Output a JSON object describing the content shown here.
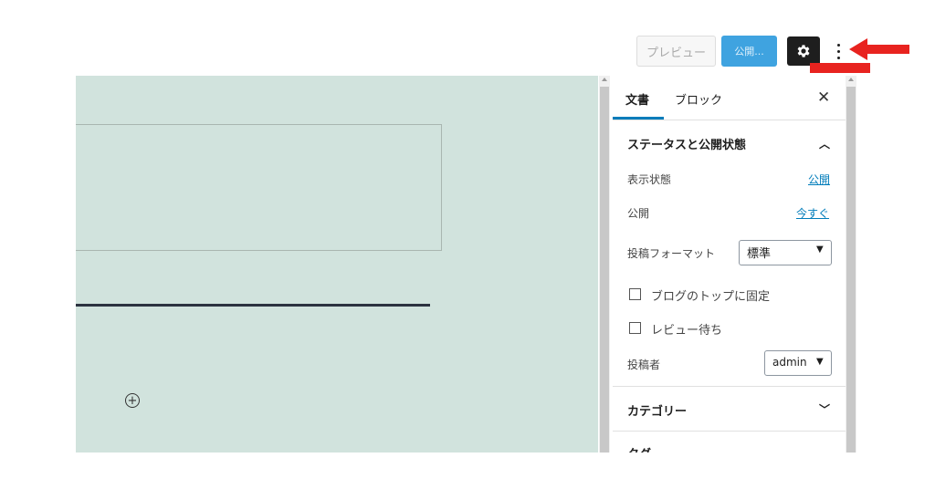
{
  "toolbar": {
    "preview_label": "プレビュー",
    "publish_label": "公開...",
    "settings_icon": "gear-icon",
    "more_icon": "more-vertical-icon"
  },
  "annotations": {
    "arrow_color": "#e8231f"
  },
  "editor": {
    "background": "#d1e3dd",
    "inserter_icon": "plus-circle-icon"
  },
  "sidebar": {
    "tabs": [
      {
        "label": "文書"
      },
      {
        "label": "ブロック"
      }
    ],
    "close_icon": "close-icon",
    "status_section": {
      "title": "ステータスと公開状態",
      "visibility_label": "表示状態",
      "visibility_value": "公開",
      "publish_label": "公開",
      "publish_value": "今すぐ",
      "format_label": "投稿フォーマット",
      "format_value": "標準",
      "sticky_label": "ブログのトップに固定",
      "pending_label": "レビュー待ち",
      "author_label": "投稿者",
      "author_value": "admin"
    },
    "categories_title": "カテゴリー",
    "tags_title": "タグ"
  }
}
